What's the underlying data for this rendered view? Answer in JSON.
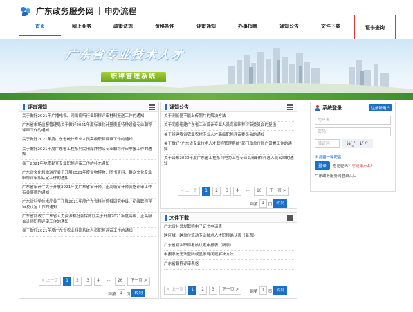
{
  "brand": {
    "name": "广东政务服务网",
    "section": "申办流程"
  },
  "nav": [
    {
      "label": "首页",
      "active": true,
      "boxed": false
    },
    {
      "label": "网上业务",
      "active": false,
      "boxed": false
    },
    {
      "label": "政策法规",
      "active": false,
      "boxed": false
    },
    {
      "label": "资格条件",
      "active": false,
      "boxed": false
    },
    {
      "label": "评审通知",
      "active": false,
      "boxed": false
    },
    {
      "label": "办事指南",
      "active": false,
      "boxed": false
    },
    {
      "label": "通知公告",
      "active": false,
      "boxed": false
    },
    {
      "label": "文件下载",
      "active": false,
      "boxed": false
    },
    {
      "label": "证书查询",
      "active": false,
      "boxed": true
    }
  ],
  "banner": {
    "title": "广东省专业技术人才",
    "subtitle": "职称管理系统"
  },
  "review_notices": {
    "title": "评审通知",
    "items": [
      "关于做好2021年广播电视、网络视听行业职称评审材料报送工作的通知",
      "广东省市场监督管理局关于做好2021年度标准化计量质量特种设备专业职称评审工作的通知",
      "关于做好2021年度广东省统计专业人员高级职称评审工作的通知",
      "关于做好2021年度广东省工程系列民用爆炸物品专业职称评审申报工作的通知",
      "关于2021年地质勘查专业职称评审工作的补充通知",
      "广东省文化和旅游厅关于开展2021年度文物博物、图书资料、群众文化专业职称评审和认定工作的通知",
      "广东省审计厅关于开展2021年度广东省审计师、正高级审计师资格评审工作有关事项的通知",
      "广东省科学技术厅关于开展2021年度广东省科技情报研究中级、初级职称评审及认定工作的通知",
      "广东省财政厅广东省人力资源和社会保障厅关于开展2021年度高级、正高级会计师职称评审工作的通知",
      "关于做好2021年度广东省农业科研系统人员职称评审工作的通知"
    ],
    "pager": {
      "prev": "< 上一页",
      "pages": [
        "1",
        "2",
        "3",
        "4"
      ],
      "ellipsis": "...",
      "last": "26",
      "next": "下一页 >",
      "goto_label": "到第",
      "goto_value": "1",
      "goto_unit": "页",
      "goto_btn": "转到"
    }
  },
  "announcements": {
    "title": "通知公告",
    "items": [
      "关于浏览器不能上传照片的解决方法",
      "关于同意组建广东省工业设计专业人员高级职称评审委员会的复函",
      "关于组建我省农业农村专业人才高级职称评审委员会的通知",
      "关于做好“广东省专业技术人才职称管理系统”部门及单位账户设置工作的通知",
      "关于公布2020年度广东省工程系列电力工程专业高级职称评选人员名单的通知"
    ],
    "pager": {
      "prev": "< 上一页",
      "pages": [
        "1",
        "2",
        "3",
        "4"
      ],
      "ellipsis": "...",
      "last": "10",
      "next": "下一页 >",
      "goto_label": "到第",
      "goto_value": "1",
      "goto_unit": "页",
      "goto_btn": "转到"
    }
  },
  "downloads": {
    "title": "文件下载",
    "items": [
      "广东省补领发职称电子证书申请表",
      "跨区域、跨单位流动专业技术人才职称确认表（新表）",
      "广东省初次职称考核认定申报表（新表）",
      "申报系统无法登陆或显示有问题解决方法",
      "广东省职称评审表格"
    ],
    "pager": {
      "prev": "< 上一页",
      "pages": [
        "1",
        "2",
        "3"
      ],
      "ellipsis": "",
      "last": "",
      "next": "下一页 >",
      "goto_label": "到第",
      "goto_value": "1",
      "goto_unit": "页",
      "goto_btn": "转到"
    }
  },
  "login": {
    "title": "系统登录",
    "register": "注册新用户",
    "username_placeholder": "用户名",
    "password_placeholder": "密码",
    "captcha_placeholder": "验证码",
    "captcha_text": "WJ V6",
    "browser_tip": "浏览器一键配置",
    "login_btn": "登录",
    "forgot_prefix": "忘记密码？",
    "forgot_username": "忘记用户名？",
    "gov_login": "广东政务服务网登录入口"
  }
}
